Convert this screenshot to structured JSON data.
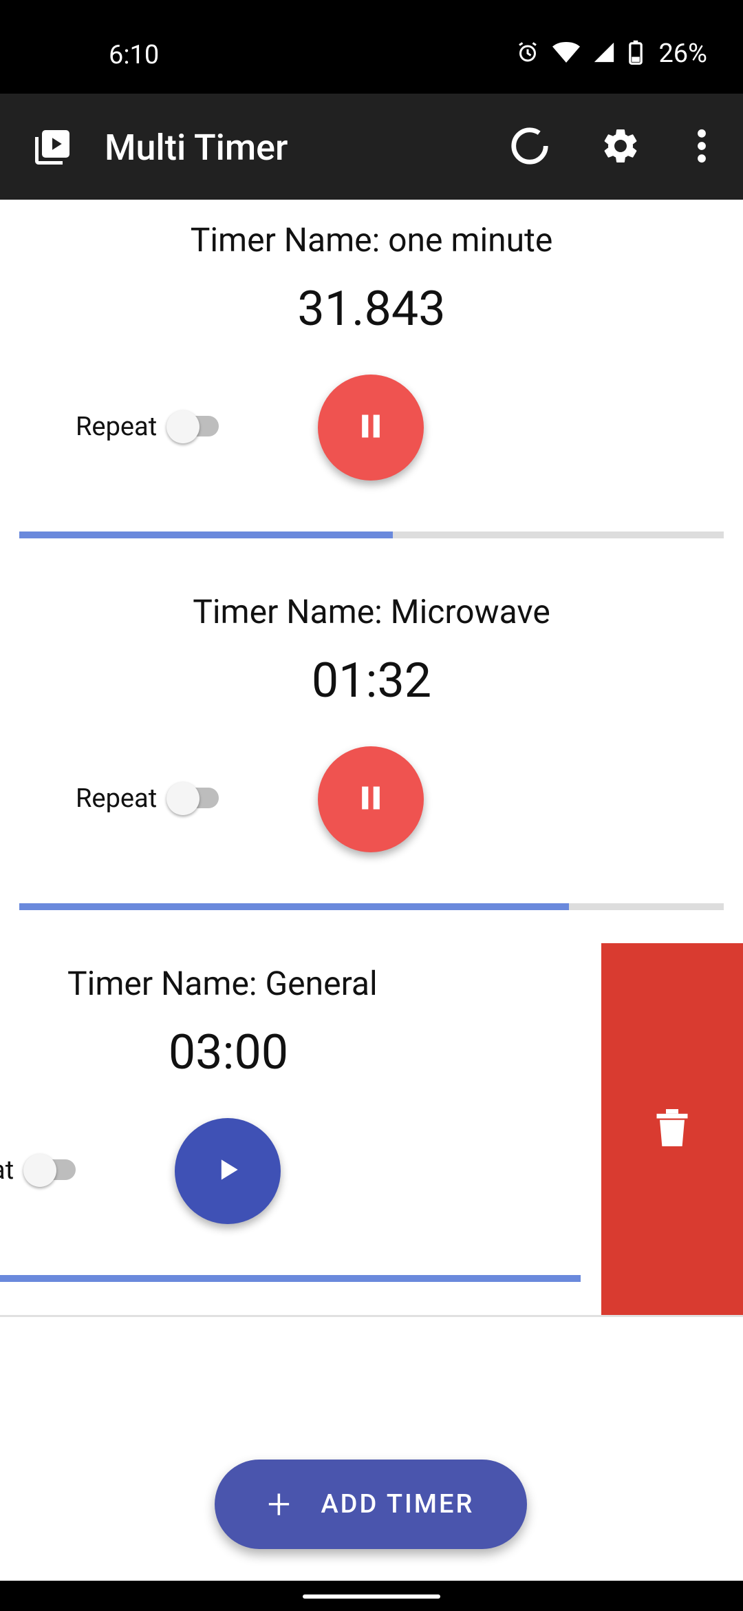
{
  "status_bar": {
    "time": "6:10",
    "battery": "26%"
  },
  "app_bar": {
    "title": "Multi Timer"
  },
  "timers": [
    {
      "name": "Timer Name: one minute",
      "time": "31.843",
      "repeat_label": "Repeat",
      "repeat_on": false,
      "state": "running",
      "progress": 0.53
    },
    {
      "name": "Timer Name: Microwave",
      "time": "01:32",
      "repeat_label": "Repeat",
      "repeat_on": false,
      "state": "running",
      "progress": 0.78
    },
    {
      "name": "Timer Name: General",
      "time": "03:00",
      "repeat_label": "Repeat",
      "repeat_on": false,
      "state": "stopped",
      "progress": 1.0
    }
  ],
  "add_button": {
    "label": "ADD TIMER"
  },
  "colors": {
    "pause": "#ef5350",
    "play": "#3f51b5",
    "delete": "#d93b30",
    "progress": "#6a89dc",
    "appbar": "#212121"
  }
}
